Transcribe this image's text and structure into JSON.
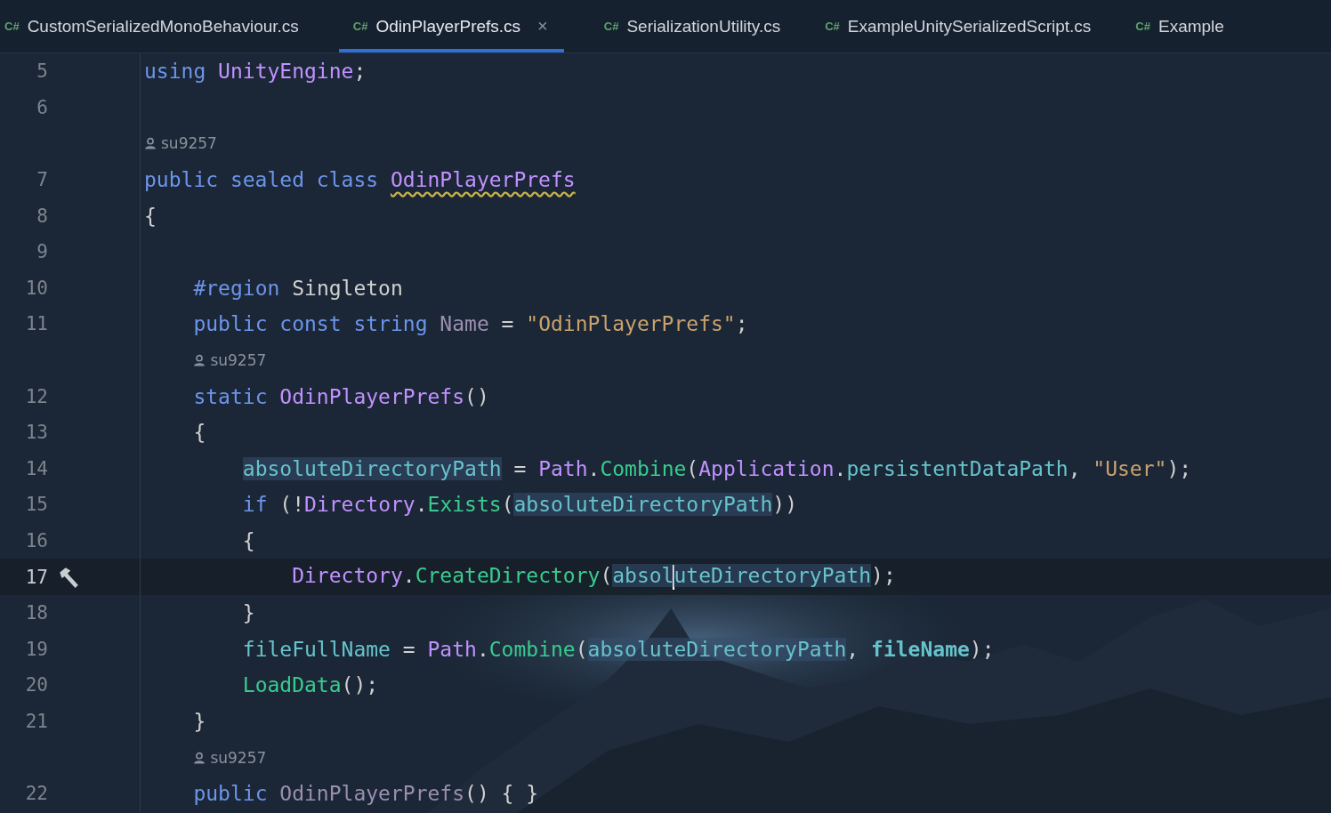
{
  "tabs": [
    {
      "icon_text": "C#",
      "label": "CustomSerializedMonoBehaviour.cs",
      "selected": false,
      "closable": false
    },
    {
      "icon_text": "C#",
      "label": "OdinPlayerPrefs.cs",
      "selected": true,
      "closable": true,
      "close_text": "×"
    },
    {
      "icon_text": "C#",
      "label": "SerializationUtility.cs",
      "selected": false,
      "closable": false
    },
    {
      "icon_text": "C#",
      "label": "ExampleUnitySerializedScript.cs",
      "selected": false,
      "closable": false
    },
    {
      "icon_text": "C#",
      "label": "Example",
      "selected": false,
      "closable": false
    }
  ],
  "lines": [
    {
      "number": "5",
      "tokens": [
        {
          "kind": "kw",
          "text": "using "
        },
        {
          "kind": "type",
          "text": "UnityEngine"
        },
        {
          "kind": "plain",
          "text": ";"
        }
      ]
    },
    {
      "number": "6"
    },
    {
      "number": "7",
      "author": "su9257",
      "tokens": [
        {
          "kind": "kw",
          "text": "public sealed class "
        },
        {
          "kind": "type",
          "text": "OdinPlayerPrefs",
          "warning": true
        }
      ]
    },
    {
      "number": "8",
      "tokens": [
        {
          "kind": "plain",
          "text": "{"
        }
      ]
    },
    {
      "number": "9"
    },
    {
      "number": "10",
      "tokens": [
        {
          "kind": "kw",
          "text": "    #region"
        },
        {
          "kind": "plain",
          "text": " Singleton"
        }
      ]
    },
    {
      "number": "11",
      "tokens": [
        {
          "kind": "kw",
          "text": "    public const string "
        },
        {
          "kind": "dim",
          "text": "Name"
        },
        {
          "kind": "plain",
          "text": " = "
        },
        {
          "kind": "string",
          "text": "\"OdinPlayerPrefs\""
        },
        {
          "kind": "plain",
          "text": ";"
        }
      ]
    },
    {
      "number": "12",
      "author": "su9257",
      "tokens": [
        {
          "kind": "kw",
          "text": "    static "
        },
        {
          "kind": "type",
          "text": "OdinPlayerPrefs"
        },
        {
          "kind": "plain",
          "text": "()"
        }
      ]
    },
    {
      "number": "13",
      "tokens": [
        {
          "kind": "plain",
          "text": "    {"
        }
      ]
    },
    {
      "number": "14",
      "tokens": [
        {
          "kind": "field",
          "text": "        absoluteDirectoryPath",
          "highlighted": true
        },
        {
          "kind": "plain",
          "text": " = "
        },
        {
          "kind": "type",
          "text": "Path"
        },
        {
          "kind": "plain",
          "text": "."
        },
        {
          "kind": "method",
          "text": "Combine"
        },
        {
          "kind": "plain",
          "text": "("
        },
        {
          "kind": "type",
          "text": "Application"
        },
        {
          "kind": "plain",
          "text": "."
        },
        {
          "kind": "field",
          "text": "persistentDataPath"
        },
        {
          "kind": "plain",
          "text": ", "
        },
        {
          "kind": "string",
          "text": "\"User\""
        },
        {
          "kind": "plain",
          "text": ");"
        }
      ]
    },
    {
      "number": "15",
      "tokens": [
        {
          "kind": "kw",
          "text": "        if"
        },
        {
          "kind": "plain",
          "text": " (!"
        },
        {
          "kind": "type",
          "text": "Directory"
        },
        {
          "kind": "plain",
          "text": "."
        },
        {
          "kind": "method",
          "text": "Exists"
        },
        {
          "kind": "plain",
          "text": "("
        },
        {
          "kind": "field",
          "text": "absoluteDirectoryPath",
          "highlighted": true
        },
        {
          "kind": "plain",
          "text": "))"
        }
      ]
    },
    {
      "number": "16",
      "tokens": [
        {
          "kind": "plain",
          "text": "        {"
        }
      ]
    },
    {
      "number": "17",
      "current": true,
      "build_marker": true,
      "tokens": [
        {
          "kind": "type",
          "text": "            Directory"
        },
        {
          "kind": "plain",
          "text": "."
        },
        {
          "kind": "method",
          "text": "CreateDirectory"
        },
        {
          "kind": "plain",
          "text": "("
        },
        {
          "kind": "field",
          "text": "absol",
          "highlighted": true,
          "caret_after": true
        },
        {
          "kind": "field",
          "text": "uteDirectoryPath",
          "highlighted": true
        },
        {
          "kind": "plain",
          "text": ");"
        }
      ]
    },
    {
      "number": "18",
      "tokens": [
        {
          "kind": "plain",
          "text": "        }"
        }
      ]
    },
    {
      "number": "19",
      "tokens": [
        {
          "kind": "field",
          "text": "        fileFullName"
        },
        {
          "kind": "plain",
          "text": " = "
        },
        {
          "kind": "type",
          "text": "Path"
        },
        {
          "kind": "plain",
          "text": "."
        },
        {
          "kind": "method",
          "text": "Combine"
        },
        {
          "kind": "plain",
          "text": "("
        },
        {
          "kind": "field",
          "text": "absoluteDirectoryPath",
          "highlighted": true
        },
        {
          "kind": "plain",
          "text": ", "
        },
        {
          "kind": "param",
          "text": "fileName"
        },
        {
          "kind": "plain",
          "text": ");"
        }
      ]
    },
    {
      "number": "20",
      "tokens": [
        {
          "kind": "method",
          "text": "        LoadData"
        },
        {
          "kind": "plain",
          "text": "();"
        }
      ]
    },
    {
      "number": "21",
      "tokens": [
        {
          "kind": "plain",
          "text": "    }"
        }
      ]
    },
    {
      "number": "22",
      "author": "su9257",
      "tokens": [
        {
          "kind": "kw",
          "text": "    public "
        },
        {
          "kind": "dim",
          "text": "OdinPlayerPrefs"
        },
        {
          "kind": "plain",
          "text": "() { }"
        }
      ]
    }
  ]
}
